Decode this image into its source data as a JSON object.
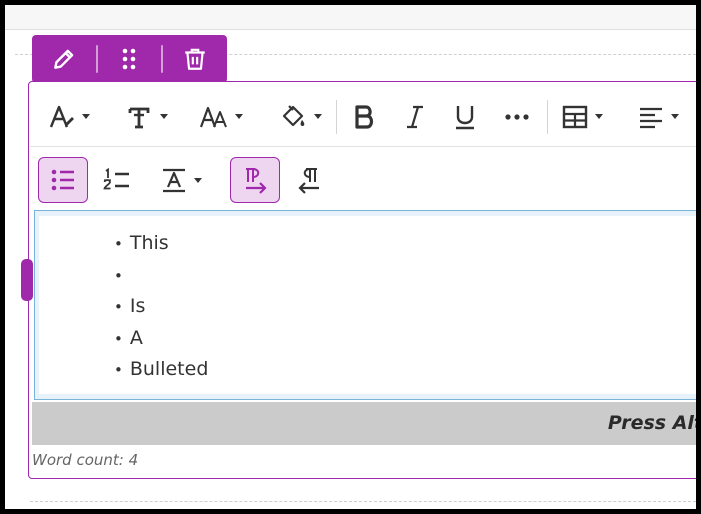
{
  "block_toolbar": {
    "edit_icon": "pencil-icon",
    "drag_icon": "drag-handle-icon",
    "delete_icon": "trash-icon",
    "color": "#a028ab"
  },
  "toolbar_row1": [
    {
      "name": "font-style-button",
      "icon": "font-style-icon",
      "has_menu": true
    },
    {
      "name": "text-format-button",
      "icon": "text-format-icon",
      "has_menu": true
    },
    {
      "name": "font-size-button",
      "icon": "font-size-icon",
      "has_menu": true
    },
    {
      "name": "text-color-button",
      "icon": "paint-bucket-icon",
      "has_menu": true
    },
    {
      "name": "bold-button",
      "icon": "bold-icon"
    },
    {
      "name": "italic-button",
      "icon": "italic-icon"
    },
    {
      "name": "underline-button",
      "icon": "underline-icon"
    },
    {
      "name": "more-options-button",
      "icon": "ellipsis-icon"
    },
    {
      "name": "table-button",
      "icon": "table-icon",
      "has_menu": true
    },
    {
      "name": "align-button",
      "icon": "align-left-icon",
      "has_menu": true
    }
  ],
  "toolbar_row2": [
    {
      "name": "bulleted-list-button",
      "icon": "bulleted-list-icon",
      "active": true
    },
    {
      "name": "numbered-list-button",
      "icon": "numbered-list-icon"
    },
    {
      "name": "clear-format-button",
      "icon": "text-clear-icon",
      "has_menu": true
    },
    {
      "name": "ltr-direction-button",
      "icon": "ltr-paragraph-icon",
      "active": true
    },
    {
      "name": "rtl-direction-button",
      "icon": "rtl-paragraph-icon"
    }
  ],
  "content": {
    "bullets": [
      "This",
      "",
      "Is",
      "A",
      "Bulleted"
    ]
  },
  "status_bar": {
    "hint": "Press Alt"
  },
  "word_count": "Word count: 4"
}
